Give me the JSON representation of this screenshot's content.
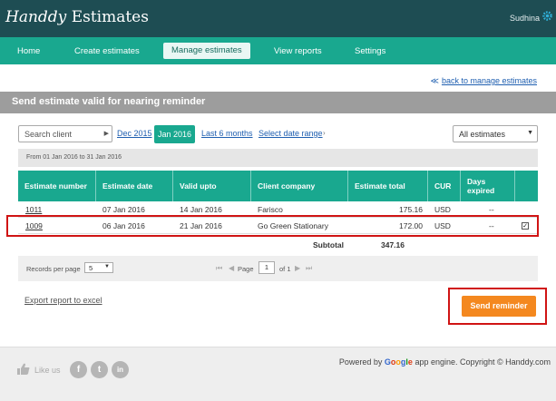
{
  "app": {
    "logo_script": "Handdy",
    "logo_text": "Estimates",
    "user_name": "Sudhina"
  },
  "nav": {
    "items": [
      {
        "label": "Home",
        "active": false
      },
      {
        "label": "Create estimates",
        "active": false
      },
      {
        "label": "Manage estimates",
        "active": true
      },
      {
        "label": "View reports",
        "active": false
      },
      {
        "label": "Settings",
        "active": false
      }
    ]
  },
  "back_link": {
    "arrow": "≪",
    "label": "back to manage estimates"
  },
  "panel": {
    "title": "Send estimate valid for nearing reminder"
  },
  "filters": {
    "client_placeholder": "Search client",
    "periods": {
      "prev": "Dec 2015",
      "current": "Jan 2016",
      "last6": "Last 6 months",
      "date_range": "Select date range"
    },
    "estimate_filter": "All estimates",
    "range_text": "From 01 Jan 2016 to 31 Jan 2016"
  },
  "table": {
    "headers": [
      "Estimate number",
      "Estimate date",
      "Valid upto",
      "Client company",
      "Estimate total",
      "CUR",
      "Days expired"
    ],
    "rows": [
      {
        "number": "1011",
        "date": "07 Jan 2016",
        "valid": "14 Jan 2016",
        "company": "Farisco",
        "total": "175.16",
        "cur": "USD",
        "days": "--",
        "checked": false
      },
      {
        "number": "1009",
        "date": "06 Jan 2016",
        "valid": "21 Jan 2016",
        "company": "Go Green Stationary",
        "total": "172.00",
        "cur": "USD",
        "days": "--",
        "checked": true
      }
    ],
    "subtotal_label": "Subtotal",
    "subtotal_value": "347.16"
  },
  "pager": {
    "rpp_label": "Records per page",
    "rpp_value": "5",
    "page_label": "Page",
    "page_value": "1",
    "of_label": "of 1"
  },
  "actions": {
    "export_label": "Export report to excel",
    "send_label": "Send reminder"
  },
  "footer": {
    "like_label": "Like us",
    "social": [
      "f",
      "t",
      "in"
    ],
    "powered_prefix": "Powered by",
    "google_letters": [
      "G",
      "o",
      "o",
      "g",
      "l",
      "e"
    ],
    "powered_suffix": "app engine. Copyright © Handdy.com"
  },
  "colors": {
    "topbar": "#1e4d53",
    "nav": "#19a88f",
    "accent_orange": "#f4881f",
    "highlight_red": "#d01414"
  }
}
